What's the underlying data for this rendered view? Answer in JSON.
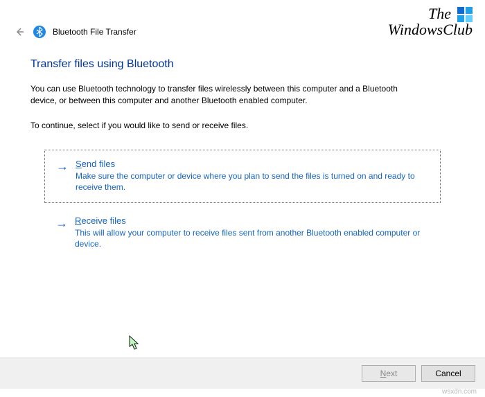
{
  "watermark": {
    "line1": "The",
    "line2": "WindowsClub",
    "site": "wsxdn.com"
  },
  "header": {
    "title": "Bluetooth File Transfer"
  },
  "page": {
    "heading": "Transfer files using Bluetooth",
    "intro": "You can use Bluetooth technology to transfer files wirelessly between this computer and a Bluetooth device, or between this computer and another Bluetooth enabled computer.",
    "continue": "To continue, select if you would like to send or receive files."
  },
  "options": {
    "send": {
      "accel": "S",
      "title_rest": "end files",
      "desc": "Make sure the computer or device where you plan to send the files is turned on and ready to receive them."
    },
    "receive": {
      "accel": "R",
      "title_rest": "eceive files",
      "desc": "This will allow your computer to receive files sent from another Bluetooth enabled computer or device."
    }
  },
  "buttons": {
    "next_accel": "N",
    "next_rest": "ext",
    "cancel": "Cancel"
  }
}
